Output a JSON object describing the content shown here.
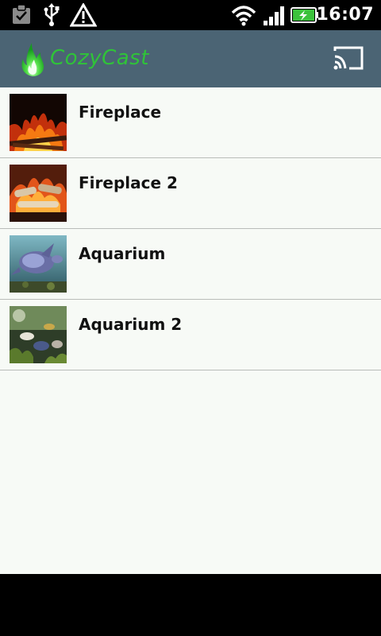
{
  "status_bar": {
    "time": "16:07",
    "icons": [
      "clipboard-check-icon",
      "usb-icon",
      "warning-icon",
      "wifi-icon",
      "signal-icon",
      "battery-charging-icon"
    ]
  },
  "action_bar": {
    "app_title": "CozyCast",
    "logo_icon": "flame-logo-icon",
    "cast_icon": "cast-icon"
  },
  "list": {
    "items": [
      {
        "title": "Fireplace",
        "thumbnail": "fireplace"
      },
      {
        "title": "Fireplace 2",
        "thumbnail": "fireplace-logs"
      },
      {
        "title": "Aquarium",
        "thumbnail": "sea-turtle"
      },
      {
        "title": "Aquarium 2",
        "thumbnail": "fish-tank"
      }
    ]
  },
  "colors": {
    "action_bar": "#4b6474",
    "accent_green": "#2fc438",
    "list_background": "#f7faf6",
    "divider": "#b9bcb9"
  }
}
